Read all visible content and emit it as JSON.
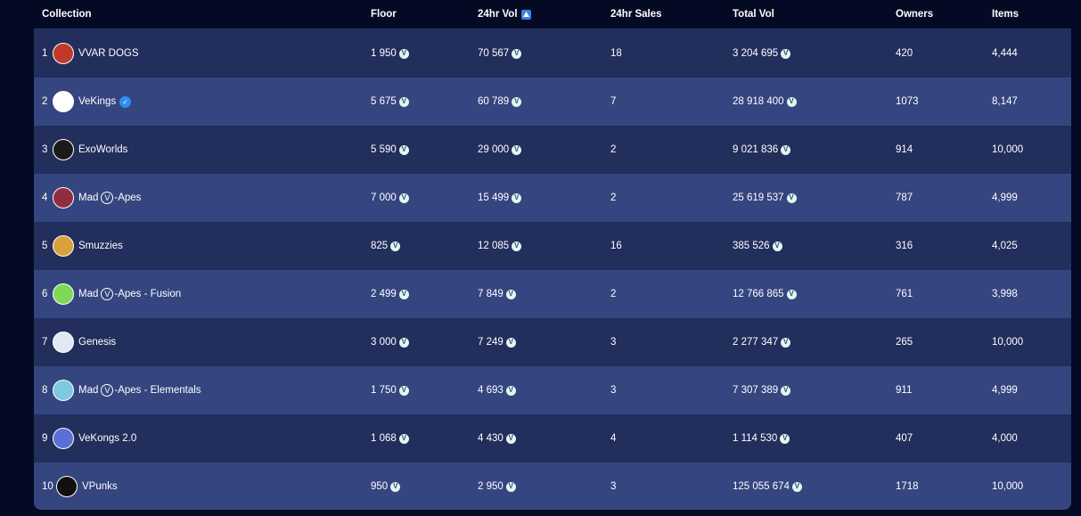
{
  "header": {
    "collection": "Collection",
    "floor": "Floor",
    "vol24": "24hr Vol",
    "sales24": "24hr Sales",
    "total_vol": "Total Vol",
    "owners": "Owners",
    "items": "Items"
  },
  "currency_icon": "vet-token-icon",
  "colors": {
    "background": "#050a24",
    "row_dark": "#222e5c",
    "row_light": "#34457f",
    "accent": "#3b82e4"
  },
  "rows": [
    {
      "rank": "1",
      "name": "VVAR DOGS",
      "avatar_color": "#c0392b",
      "floor": "1 950",
      "vol24": "70 567",
      "sales24": "18",
      "total_vol": "3 204 695",
      "owners": "420",
      "items": "4,444"
    },
    {
      "rank": "2",
      "name": "VeKings",
      "avatar_color": "#ffffff",
      "verified": true,
      "floor": "5 675",
      "vol24": "60 789",
      "sales24": "7",
      "total_vol": "28 918 400",
      "owners": "1073",
      "items": "8,147"
    },
    {
      "rank": "3",
      "name": "ExoWorlds",
      "avatar_color": "#1a1a1a",
      "floor": "5 590",
      "vol24": "29 000",
      "sales24": "2",
      "total_vol": "9 021 836",
      "owners": "914",
      "items": "10,000"
    },
    {
      "rank": "4",
      "name_pre": "Mad",
      "name_post": "-Apes",
      "name_v": "V",
      "avatar_color": "#8e2e3e",
      "floor": "7 000",
      "vol24": "15 499",
      "sales24": "2",
      "total_vol": "25 619 537",
      "owners": "787",
      "items": "4,999"
    },
    {
      "rank": "5",
      "name": "Smuzzies",
      "avatar_color": "#d9a13b",
      "floor": "825",
      "vol24": "12 085",
      "sales24": "16",
      "total_vol": "385 526",
      "owners": "316",
      "items": "4,025"
    },
    {
      "rank": "6",
      "name_pre": "Mad",
      "name_post": "-Apes - Fusion",
      "name_v": "V",
      "avatar_color": "#7ed957",
      "floor": "2 499",
      "vol24": "7 849",
      "sales24": "2",
      "total_vol": "12 766 865",
      "owners": "761",
      "items": "3,998"
    },
    {
      "rank": "7",
      "name": "Genesis",
      "avatar_color": "#dfe8f3",
      "floor": "3 000",
      "vol24": "7 249",
      "sales24": "3",
      "total_vol": "2 277 347",
      "owners": "265",
      "items": "10,000"
    },
    {
      "rank": "8",
      "name_pre": "Mad",
      "name_post": "-Apes - Elementals",
      "name_v": "V",
      "avatar_color": "#7ec8e3",
      "floor": "1 750",
      "vol24": "4 693",
      "sales24": "3",
      "total_vol": "7 307 389",
      "owners": "911",
      "items": "4,999"
    },
    {
      "rank": "9",
      "name": "VeKongs 2.0",
      "avatar_color": "#5b6fd6",
      "floor": "1 068",
      "vol24": "4 430",
      "sales24": "4",
      "total_vol": "1 114 530",
      "owners": "407",
      "items": "4,000"
    },
    {
      "rank": "10",
      "name": "VPunks",
      "avatar_color": "#111111",
      "floor": "950",
      "vol24": "2 950",
      "sales24": "3",
      "total_vol": "125 055 674",
      "owners": "1718",
      "items": "10,000"
    }
  ]
}
